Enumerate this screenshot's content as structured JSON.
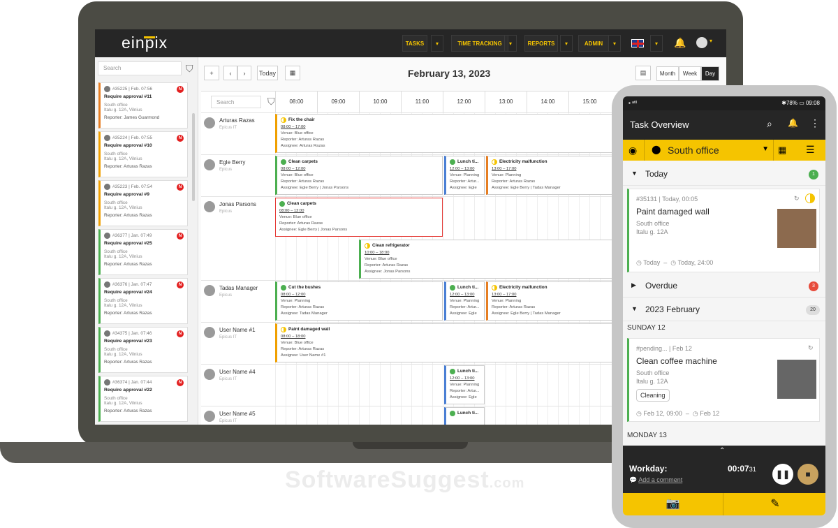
{
  "app": {
    "logo": "einpix"
  },
  "topnav": {
    "tasks": "TASKS",
    "time_tracking": "TIME TRACKING",
    "reports": "REPORTS",
    "admin": "ADMIN"
  },
  "sidebar": {
    "search_placeholder": "Search",
    "cards": [
      {
        "meta": "#35225 | Feb. 07:56",
        "title": "Require approval #11",
        "venue": "South office",
        "address": "Italu g. 12A, Vilnius",
        "reporter": "Reporter: James Guarmond",
        "accent": "#e67e22"
      },
      {
        "meta": "#35224 | Feb. 07:55",
        "title": "Require approval #10",
        "venue": "South office",
        "address": "Italu g. 12A, Vilnius",
        "reporter": "Reporter: Arturas Razas",
        "accent": "#f0a000"
      },
      {
        "meta": "#35223 | Feb. 07:54",
        "title": "Require approval #9",
        "venue": "South office",
        "address": "Italu g. 12A, Vilnius",
        "reporter": "Reporter: Arturas Razas",
        "accent": "#f0a000"
      },
      {
        "meta": "#36377 | Jan. 07:49",
        "title": "Require approval #25",
        "venue": "South office",
        "address": "Italu g. 12A, Vilnius",
        "reporter": "Reporter: Arturas Razas",
        "accent": "#4caf50"
      },
      {
        "meta": "#36376 | Jan. 07:47",
        "title": "Require approval #24",
        "venue": "South office",
        "address": "Italu g. 12A, Vilnius",
        "reporter": "Reporter: Arturas Razas",
        "accent": "#4caf50"
      },
      {
        "meta": "#34375 | Jan. 07:46",
        "title": "Require approval #23",
        "venue": "South office",
        "address": "Italu g. 12A, Vilnius",
        "reporter": "Reporter: Arturas Razas",
        "accent": "#4caf50"
      },
      {
        "meta": "#36374 | Jan. 07:44",
        "title": "Require approval #22",
        "venue": "South office",
        "address": "Italu g. 12A, Vilnius",
        "reporter": "Reporter: Arturas Razas",
        "accent": "#4caf50"
      }
    ]
  },
  "toolbar": {
    "add": "+",
    "prev": "‹",
    "next": "›",
    "today": "Today",
    "date": "February 13, 2023",
    "views": [
      "Month",
      "Week",
      "Day"
    ]
  },
  "grid": {
    "search_placeholder": "Search",
    "hours": [
      "08:00",
      "09:00",
      "10:00",
      "11:00",
      "12:00",
      "13:00",
      "14:00",
      "15:00"
    ],
    "people": [
      {
        "name": "Arturas Razas",
        "org": "Epicus IT"
      },
      {
        "name": "Egle Berry",
        "org": "Epicus"
      },
      {
        "name": "Jonas Parsons",
        "org": "Epicus"
      },
      {
        "name": "Tadas Manager",
        "org": "Epicus"
      },
      {
        "name": "User Name #1",
        "org": "Epicus IT"
      },
      {
        "name": "User Name #4",
        "org": "Epicus IT"
      },
      {
        "name": "User Name #5",
        "org": "Epicus IT"
      }
    ],
    "events": [
      {
        "title": "Fix the chair",
        "time": "08:00 – 17:00",
        "venue": "Venue: Blue office",
        "reporter": "Reporter: Arturas Razas",
        "assignee": "Assignee: Arturas Razas"
      },
      {
        "title": "Clean carpets",
        "time": "08:00 – 12:00",
        "venue": "Venue: Blue office",
        "reporter": "Reporter: Arturas Razas",
        "assignee": "Assignee: Egle Berry | Jonas Parsons"
      },
      {
        "title": "Lunch ti...",
        "time": "12:00 – 13:00",
        "venue": "Venue: Planning",
        "reporter": "Reporter: Artur...",
        "assignee": "Assignee: Egle ..."
      },
      {
        "title": "Electricity malfunction",
        "time": "13:00 – 17:00",
        "venue": "Venue: Planning",
        "reporter": "Reporter: Arturas Razas",
        "assignee": "Assignee: Egle Berry | Tadas Manager"
      },
      {
        "title": "Clean carpets",
        "time": "08:00 – 12:00",
        "venue": "Venue: Blue office",
        "reporter": "Reporter: Arturas Razas",
        "assignee": "Assignee: Egle Berry | Jonas Parsons"
      },
      {
        "title": "Clean refrigerator",
        "time": "10:00 – 18:00",
        "venue": "Venue: Blue office",
        "reporter": "Reporter: Arturas Razas",
        "assignee": "Assignee: Jonas Parsons"
      },
      {
        "title": "Cut the bushes",
        "time": "08:00 – 12:00",
        "venue": "Venue: Planning",
        "reporter": "Reporter: Arturas Razas",
        "assignee": "Assignee: Tadas Manager"
      },
      {
        "title": "Lunch ti...",
        "time": "12:00 – 13:00",
        "venue": "Venue: Planning",
        "reporter": "Reporter: Artur...",
        "assignee": "Assignee: Egle ..."
      },
      {
        "title": "Electricity malfunction",
        "time": "13:00 – 17:00",
        "venue": "Venue: Planning",
        "reporter": "Reporter: Arturas Razas",
        "assignee": "Assignee: Egle Berry | Tadas Manager"
      },
      {
        "title": "Paint damaged wall",
        "time": "08:00 – 18:00",
        "venue": "Venue: Blue office",
        "reporter": "Reporter: Arturas Razas",
        "assignee": "Assignee: User Name #1"
      },
      {
        "title": "Lunch ti...",
        "time": "12:00 – 13:00",
        "venue": "Venue: Planning",
        "reporter": "Reporter: Artur...",
        "assignee": "Assignee: Egle ..."
      },
      {
        "title": "Lunch ti...",
        "time": "",
        "venue": "",
        "reporter": "",
        "assignee": ""
      }
    ]
  },
  "phone": {
    "status_left": "▪ ᵃᵗˡˡ",
    "status_right": "✱78% ▭ 09:08",
    "title": "Task Overview",
    "location": "South office",
    "today_label": "Today",
    "today_count": "1",
    "card1": {
      "meta": "#35131 | Today, 00:05",
      "title": "Paint damaged wall",
      "venue": "South office",
      "address": "Italu g. 12A",
      "start": "Today",
      "end": "Today, 24:00"
    },
    "overdue_label": "Overdue",
    "overdue_count": "3",
    "month_label": "2023 February",
    "month_count": "20",
    "day1": "SUNDAY 12",
    "card2": {
      "meta": "#pending... | Feb 12",
      "title": "Clean coffee machine",
      "venue": "South office",
      "address": "Italu g. 12A",
      "tag": "Cleaning",
      "start": "Feb 12, 09:00",
      "end": "Feb 12"
    },
    "day2": "MONDAY 13",
    "workday": "Workday:",
    "timer": "00:07",
    "timer_sec": "31",
    "comment": "Add a comment"
  },
  "watermark": {
    "main": "SoftwareSuggest",
    "suffix": ".com"
  },
  "colors": {
    "brand_yellow": "#f5c400",
    "dark": "#262626",
    "red": "#e32020",
    "green": "#4caf50"
  }
}
